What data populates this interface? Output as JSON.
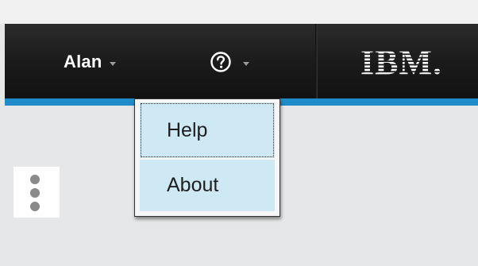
{
  "header": {
    "user_name": "Alan",
    "help_icon": "question-circle-icon",
    "logo_text": "IBM."
  },
  "help_dropdown": {
    "items": [
      {
        "label": "Help"
      },
      {
        "label": "About"
      }
    ]
  },
  "side": {
    "menu_icon": "vertical-ellipsis-icon"
  },
  "colors": {
    "header_bg": "#1a1a1a",
    "accent_bar": "#1f8cc9",
    "menu_item_bg": "#cfe9f4",
    "page_bg": "#e6e7e8"
  }
}
